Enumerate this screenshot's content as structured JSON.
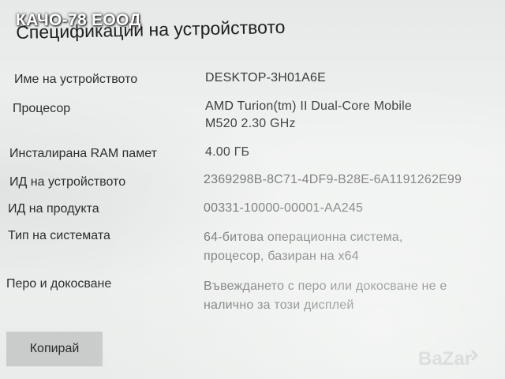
{
  "watermark": {
    "seller": "КАЧО-78 ЕООД"
  },
  "header": {
    "title": "Спецификации на устройството"
  },
  "specs": [
    {
      "label": "Име на устройството",
      "value_lines": [
        "DESKTOP-3H01A6E"
      ]
    },
    {
      "label": "Процесор",
      "value_lines": [
        "AMD Turion(tm) II Dual-Core Mobile",
        "M520   2.30 GHz"
      ]
    },
    {
      "label": "Инсталирана RAM памет",
      "value_lines": [
        "4.00 ГБ"
      ]
    },
    {
      "label": "ИД на устройството",
      "value_lines": [
        "2369298B-8C71-4DF9-B28E-6A1191262E99"
      ]
    },
    {
      "label": "ИД на продукта",
      "value_lines": [
        "00331-10000-00001-AA245"
      ]
    },
    {
      "label": "Тип на системата",
      "value_lines": [
        "64-битова операционна система,",
        "процесор, базиран на x64"
      ]
    },
    {
      "label": "Перо и докосване",
      "value_lines": [
        "Въвеждането с перо или докосване не е",
        "налично за този дисплей"
      ]
    }
  ],
  "actions": {
    "copy_label": "Копирай"
  },
  "logo": {
    "icon": "bazar-logo-icon",
    "text": "BaZar",
    "color": "#bfc3c2"
  }
}
